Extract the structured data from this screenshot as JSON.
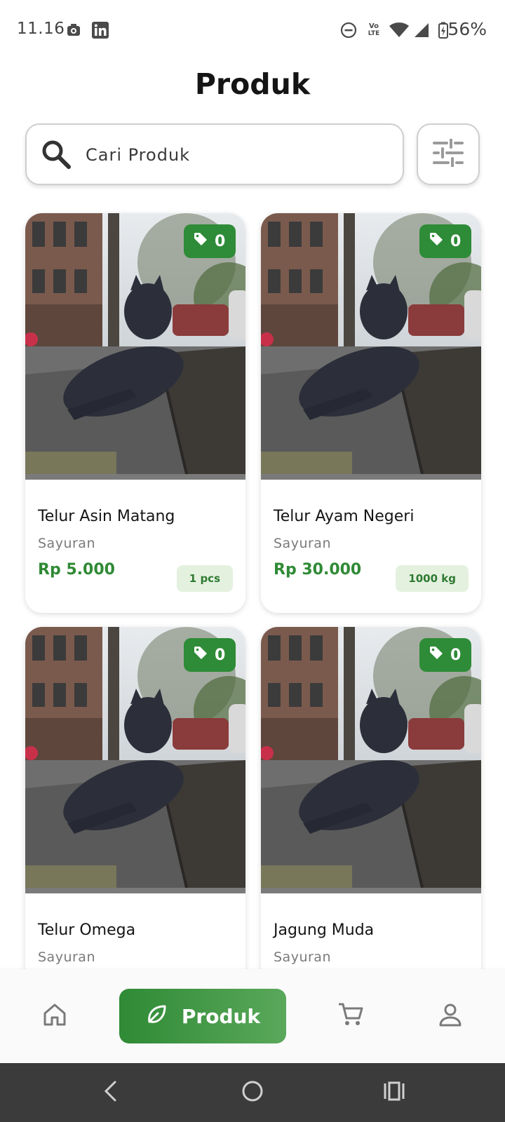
{
  "status_bar": {
    "time": "11.16",
    "battery": "56%",
    "icons": [
      "camera-app-icon",
      "linkedin-icon",
      "dnd-icon",
      "volte-icon",
      "wifi-icon",
      "signal-icon",
      "battery-icon"
    ],
    "volte_top": "Vo",
    "volte_bottom": "LTE"
  },
  "header": {
    "title": "Produk"
  },
  "search": {
    "placeholder": "Cari Produk",
    "value": ""
  },
  "products": [
    {
      "name": "Telur Asin Matang",
      "category": "Sayuran",
      "price": "Rp 5.000",
      "stock": "1 pcs",
      "tag_count": "0"
    },
    {
      "name": "Telur Ayam Negeri",
      "category": "Sayuran",
      "price": "Rp 30.000",
      "stock": "1000 kg",
      "tag_count": "0"
    },
    {
      "name": "Telur Omega",
      "category": "Sayuran",
      "price": "",
      "stock": "",
      "tag_count": "0"
    },
    {
      "name": "Jagung Muda",
      "category": "Sayuran",
      "price": "",
      "stock": "",
      "tag_count": "0"
    }
  ],
  "bottom_nav": {
    "items": [
      {
        "icon": "home-icon",
        "label": ""
      },
      {
        "icon": "leaf-icon",
        "label": "Produk",
        "active": true
      },
      {
        "icon": "cart-icon",
        "label": ""
      },
      {
        "icon": "profile-icon",
        "label": ""
      }
    ]
  },
  "colors": {
    "primary": "#2e8b37",
    "price": "#2f8a35",
    "stock_badge_bg": "#e4f1df",
    "system_nav": "#3b3b3b"
  }
}
